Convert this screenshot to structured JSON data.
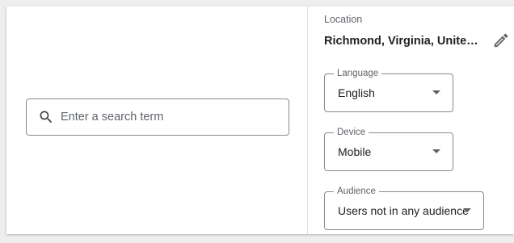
{
  "search": {
    "placeholder": "Enter a search term",
    "value": ""
  },
  "location": {
    "label": "Location",
    "value": "Richmond, Virginia, United States"
  },
  "language": {
    "label": "Language",
    "value": "English"
  },
  "device": {
    "label": "Device",
    "value": "Mobile"
  },
  "audience": {
    "label": "Audience",
    "value": "Users not in any audience"
  },
  "icons": {
    "search": "search-icon",
    "edit": "pencil-edit-icon",
    "dropdown": "dropdown-arrow-icon"
  },
  "colors": {
    "border": "#8a8a8a",
    "text": "#202124",
    "secondary_text": "#5f6368"
  }
}
